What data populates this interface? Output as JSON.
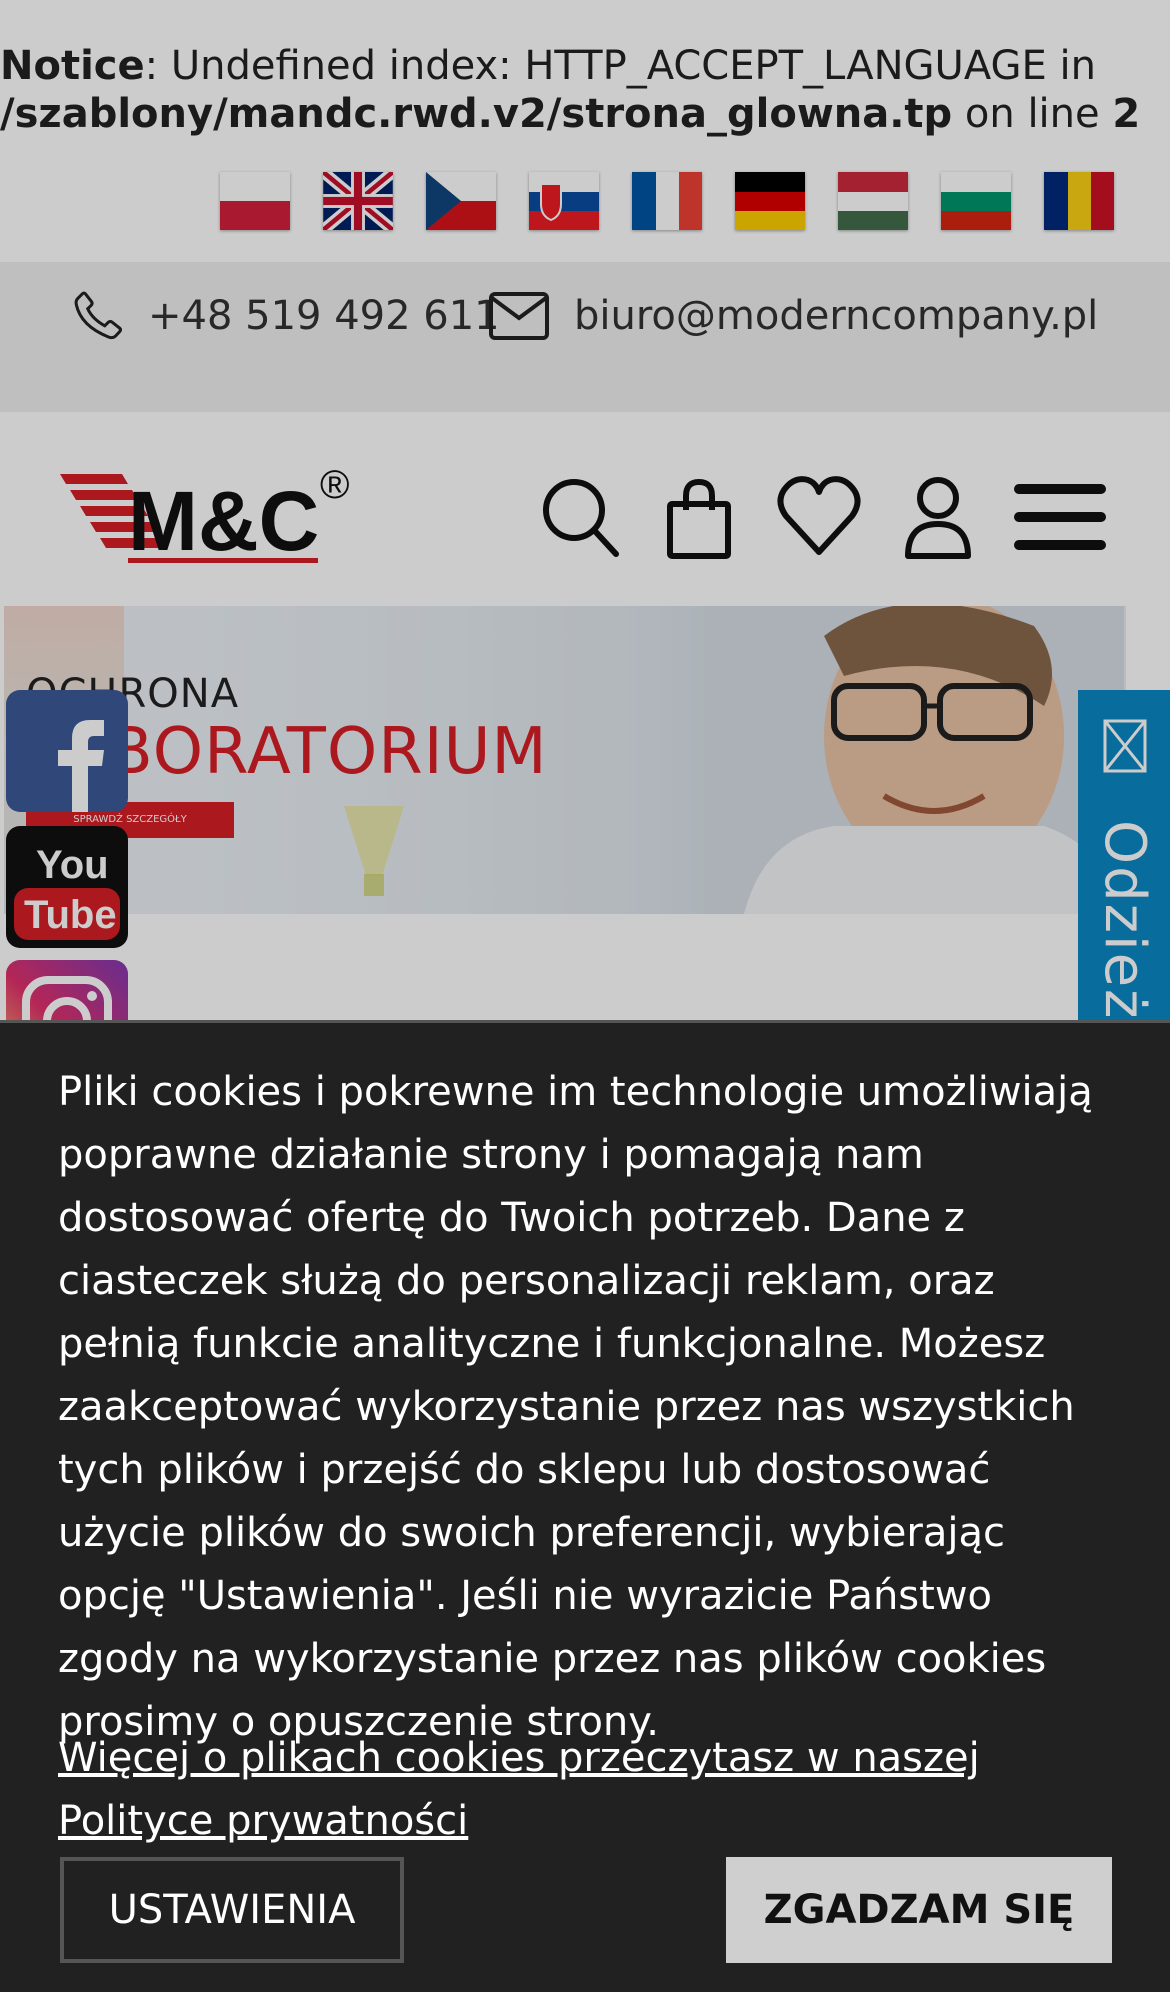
{
  "notice": {
    "label": "Notice",
    "text1": ": Undefined index: HTTP_ACCEPT_LANGUAGE in",
    "path": "/szablony/mandc.rwd.v2/strona_glowna.tp",
    "text2": " on line ",
    "line": "2"
  },
  "languages": [
    "pl-flag-icon",
    "uk-flag-icon",
    "cz-flag-icon",
    "sk-flag-icon",
    "fr-flag-icon",
    "de-flag-icon",
    "hu-flag-icon",
    "bg-flag-icon",
    "ro-flag-icon"
  ],
  "contact": {
    "phone": "+48 519 492 611",
    "email": "biuro@moderncompany.pl"
  },
  "header": {
    "logo_text": "M&C",
    "logo_mark": "®",
    "icons": [
      "search-icon",
      "cart-icon",
      "heart-icon",
      "user-icon",
      "menu-icon"
    ]
  },
  "hero": {
    "subtitle": "OCHRONA",
    "title": "LABORATORIUM",
    "cta": "SPRAWDŹ SZCZEGÓŁY"
  },
  "social": [
    "facebook-icon",
    "youtube-icon",
    "instagram-icon"
  ],
  "side_tab": {
    "label": "Odzież z logo"
  },
  "cookie": {
    "message": "Pliki cookies i pokrewne im technologie umożliwiają poprawne działanie strony i pomagają nam dostosować ofertę do Twoich potrzeb. Dane z ciasteczek służą do personalizacji reklam, oraz pełnią funkcie analityczne i funkcjonalne. Możesz zaakceptować wykorzystanie przez nas wszystkich tych plików i przejść do sklepu lub dostosować użycie plików do swoich preferencji, wybierając opcję \"Ustawienia\". Jeśli nie wyrazicie Państwo zgody na wykorzystanie przez nas plików cookies prosimy o opuszczenie strony.",
    "more_link": "Więcej o plikach cookies przeczytasz w naszej Polityce prywatności",
    "settings_label": "USTAWIENIA",
    "agree_label": "ZGADZAM SIĘ"
  },
  "colors": {
    "brand_red": "#d61f26",
    "side_tab_blue": "#0a87c4",
    "cookie_bg": "#212121"
  }
}
